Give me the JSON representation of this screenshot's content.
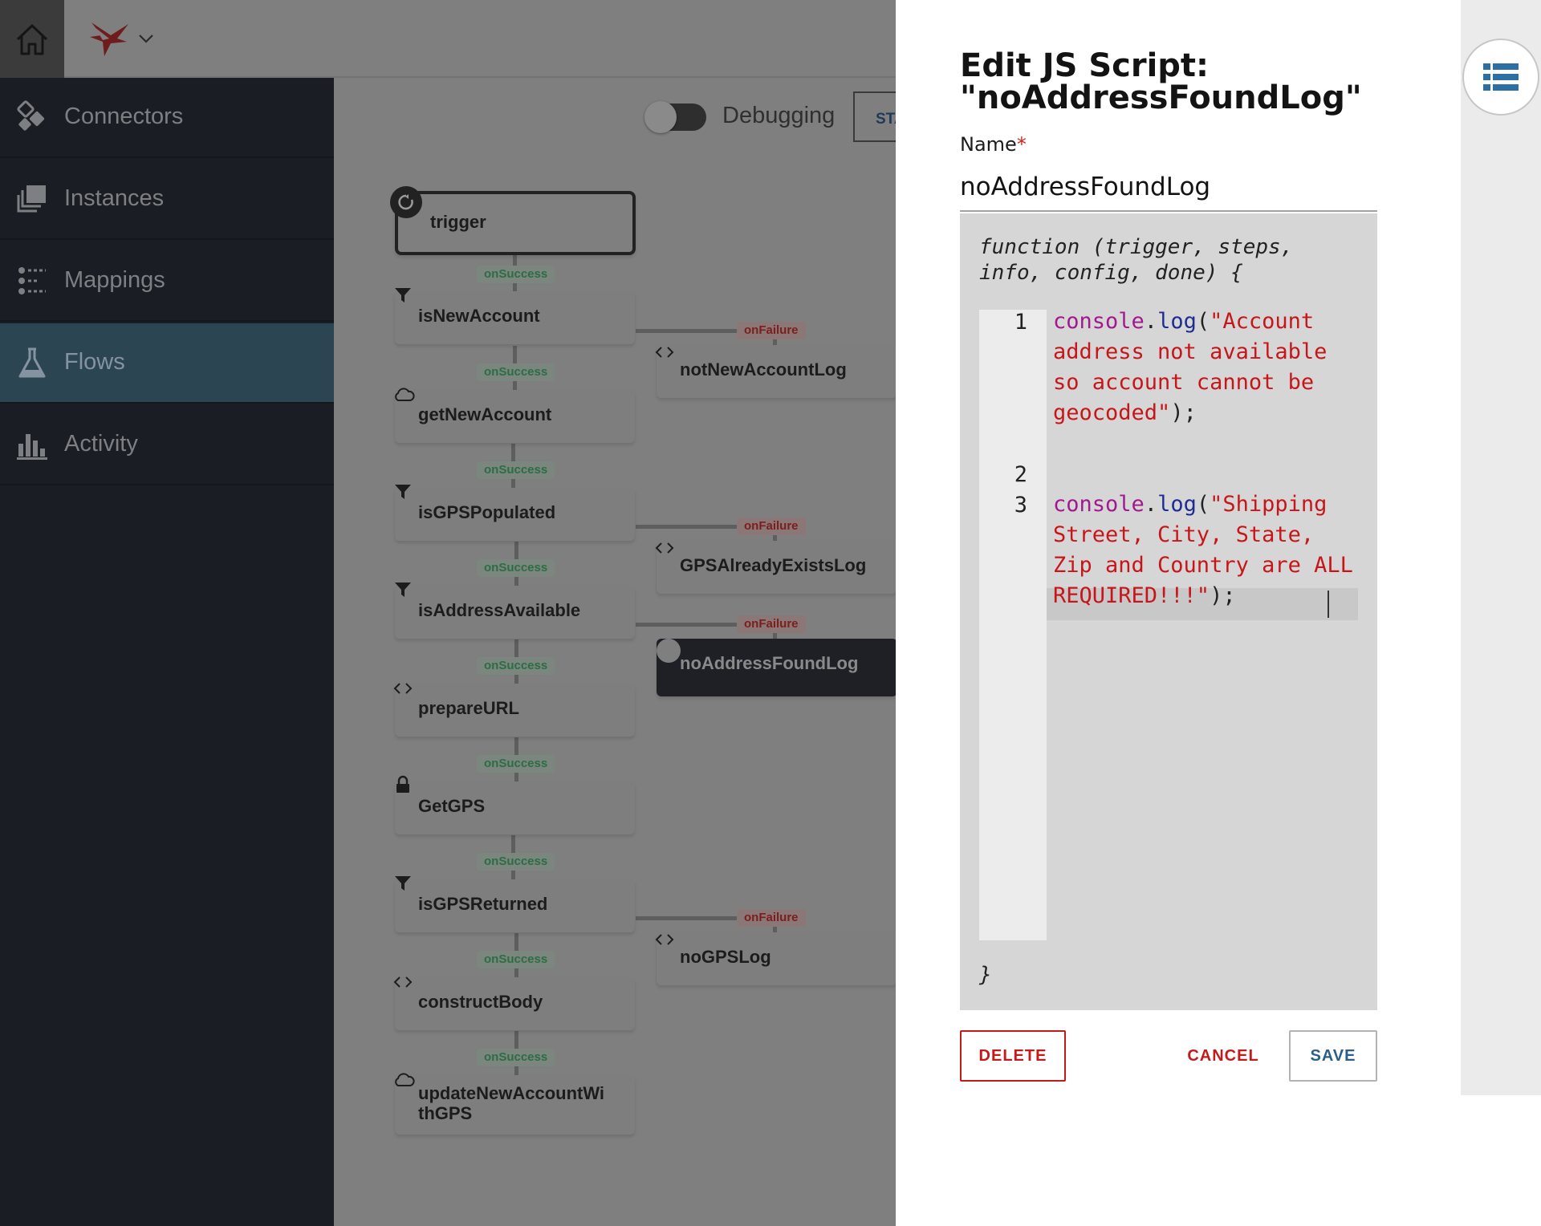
{
  "nav": {
    "items": [
      {
        "label": "Connectors",
        "icon": "connectors-icon"
      },
      {
        "label": "Instances",
        "icon": "instances-icon"
      },
      {
        "label": "Mappings",
        "icon": "mappings-icon"
      },
      {
        "label": "Flows",
        "icon": "flask-icon",
        "active": true
      },
      {
        "label": "Activity",
        "icon": "bar-chart-icon"
      }
    ]
  },
  "toolbar": {
    "debugging_label": "Debugging",
    "start_label": "START"
  },
  "flow": {
    "trigger": "trigger",
    "success_label": "onSuccess",
    "failure_label": "onFailure",
    "steps": [
      {
        "name": "isNewAccount",
        "icon": "filter-icon"
      },
      {
        "name": "getNewAccount",
        "icon": "cloud-icon"
      },
      {
        "name": "isGPSPopulated",
        "icon": "filter-icon"
      },
      {
        "name": "isAddressAvailable",
        "icon": "filter-icon"
      },
      {
        "name": "prepareURL",
        "icon": "code-icon"
      },
      {
        "name": "GetGPS",
        "icon": "lock-icon"
      },
      {
        "name": "isGPSReturned",
        "icon": "filter-icon"
      },
      {
        "name": "constructBody",
        "icon": "code-icon"
      },
      {
        "name": "updateNewAccountWithGPS",
        "line1": "updateNewAccountWi",
        "line2": "thGPS",
        "icon": "cloud-icon"
      }
    ],
    "failure_steps": [
      {
        "name": "notNewAccountLog",
        "icon": "code-icon"
      },
      {
        "name": "GPSAlreadyExistsLog",
        "icon": "code-icon"
      },
      {
        "name": "noAddressFoundLog",
        "icon": "code-icon",
        "selected": true
      },
      {
        "name": "noGPSLog",
        "icon": "code-icon"
      }
    ]
  },
  "panel": {
    "title_line1": "Edit JS Script:",
    "title_line2": "\"noAddressFoundLog\"",
    "name_label": "Name",
    "required_mark": "*",
    "name_value": "noAddressFoundLog",
    "function_signature": "function (trigger, steps, info, config, done) {",
    "closing_brace": "}",
    "code_lines": [
      {
        "number": "1",
        "object": "console",
        "dot": ".",
        "method": "log",
        "open": "(",
        "string": "\"Account address not available so account cannot be geocoded\"",
        "close": ");"
      },
      {
        "number": "2",
        "object": "",
        "dot": "",
        "method": "",
        "open": "",
        "string": "",
        "close": ""
      },
      {
        "number": "3",
        "object": "console",
        "dot": ".",
        "method": "log",
        "open": "(",
        "string": "\"Shipping Street, City, State, Zip and Country are ALL REQUIRED!!!\"",
        "close": ");"
      }
    ],
    "buttons": {
      "delete": "DELETE",
      "cancel": "CANCEL",
      "save": "SAVE"
    }
  },
  "colors": {
    "sidebar_bg": "#1b1d24",
    "active_nav": "#2c4552",
    "danger": "#c41a1a",
    "save_text": "#2b5f85",
    "code_keyword": "#a0198d",
    "code_string": "#c7161a",
    "code_method": "#1d2d91",
    "success_badge_text": "#2d6d44",
    "failure_badge_text": "#7a1e1e"
  }
}
